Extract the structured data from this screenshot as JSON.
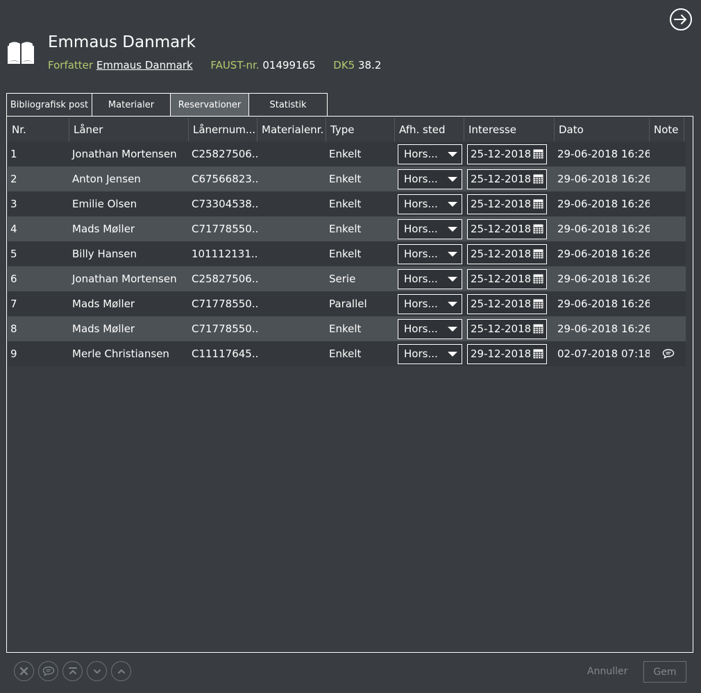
{
  "record": {
    "title": "Emmaus Danmark",
    "author_label": "Forfatter",
    "author": "Emmaus Danmark",
    "faust_label": "FAUST-nr.",
    "faust": "01499165",
    "dk5_label": "DK5",
    "dk5": "38.2"
  },
  "tabs": [
    {
      "label": "Bibliografisk post"
    },
    {
      "label": "Materialer"
    },
    {
      "label": "Reservationer",
      "active": true
    },
    {
      "label": "Statistik"
    }
  ],
  "table": {
    "columns": [
      "Nr.",
      "Låner",
      "Lånernum...",
      "Materialenr.",
      "Type",
      "Afh. sted",
      "Interesse",
      "Dato",
      "Note"
    ],
    "rows": [
      {
        "nr": "1",
        "laner": "Jonathan Mortensen",
        "lnum": "C25827506...",
        "mat": "",
        "type": "Enkelt",
        "afh": "Hors...",
        "interesse": "25-12-2018",
        "dato": "29-06-2018 16:26",
        "note": false
      },
      {
        "nr": "2",
        "laner": "Anton Jensen",
        "lnum": "C67566823...",
        "mat": "",
        "type": "Enkelt",
        "afh": "Hors...",
        "interesse": "25-12-2018",
        "dato": "29-06-2018 16:26",
        "note": false
      },
      {
        "nr": "3",
        "laner": "Emilie Olsen",
        "lnum": "C73304538...",
        "mat": "",
        "type": "Enkelt",
        "afh": "Hors...",
        "interesse": "25-12-2018",
        "dato": "29-06-2018 16:26",
        "note": false
      },
      {
        "nr": "4",
        "laner": "Mads Møller",
        "lnum": "C71778550...",
        "mat": "",
        "type": "Enkelt",
        "afh": "Hors...",
        "interesse": "25-12-2018",
        "dato": "29-06-2018 16:26",
        "note": false
      },
      {
        "nr": "5",
        "laner": "Billy Hansen",
        "lnum": "101112131...",
        "mat": "",
        "type": "Enkelt",
        "afh": "Hors...",
        "interesse": "25-12-2018",
        "dato": "29-06-2018 16:26",
        "note": false
      },
      {
        "nr": "6",
        "laner": "Jonathan Mortensen",
        "lnum": "C25827506...",
        "mat": "",
        "type": "Serie",
        "afh": "Hors...",
        "interesse": "25-12-2018",
        "dato": "29-06-2018 16:26",
        "note": false
      },
      {
        "nr": "7",
        "laner": "Mads Møller",
        "lnum": "C71778550...",
        "mat": "",
        "type": "Parallel",
        "afh": "Hors...",
        "interesse": "25-12-2018",
        "dato": "29-06-2018 16:26",
        "note": false
      },
      {
        "nr": "8",
        "laner": "Mads Møller",
        "lnum": "C71778550...",
        "mat": "",
        "type": "Enkelt",
        "afh": "Hors...",
        "interesse": "25-12-2018",
        "dato": "29-06-2018 16:26",
        "note": false
      },
      {
        "nr": "9",
        "laner": "Merle Christiansen",
        "lnum": "C11117645...",
        "mat": "",
        "type": "Enkelt",
        "afh": "Hors...",
        "interesse": "29-12-2018",
        "dato": "02-07-2018 07:18",
        "note": true
      }
    ]
  },
  "footer": {
    "icons": [
      "delete-icon",
      "comment-icon",
      "move-top-icon",
      "move-down-icon",
      "move-up-icon"
    ],
    "cancel_label": "Annuller",
    "save_label": "Gem"
  },
  "colors": {
    "background": "#393d41",
    "label_accent": "#b5c96f",
    "row_alt": "#4c5155",
    "disabled": "#84888c"
  }
}
